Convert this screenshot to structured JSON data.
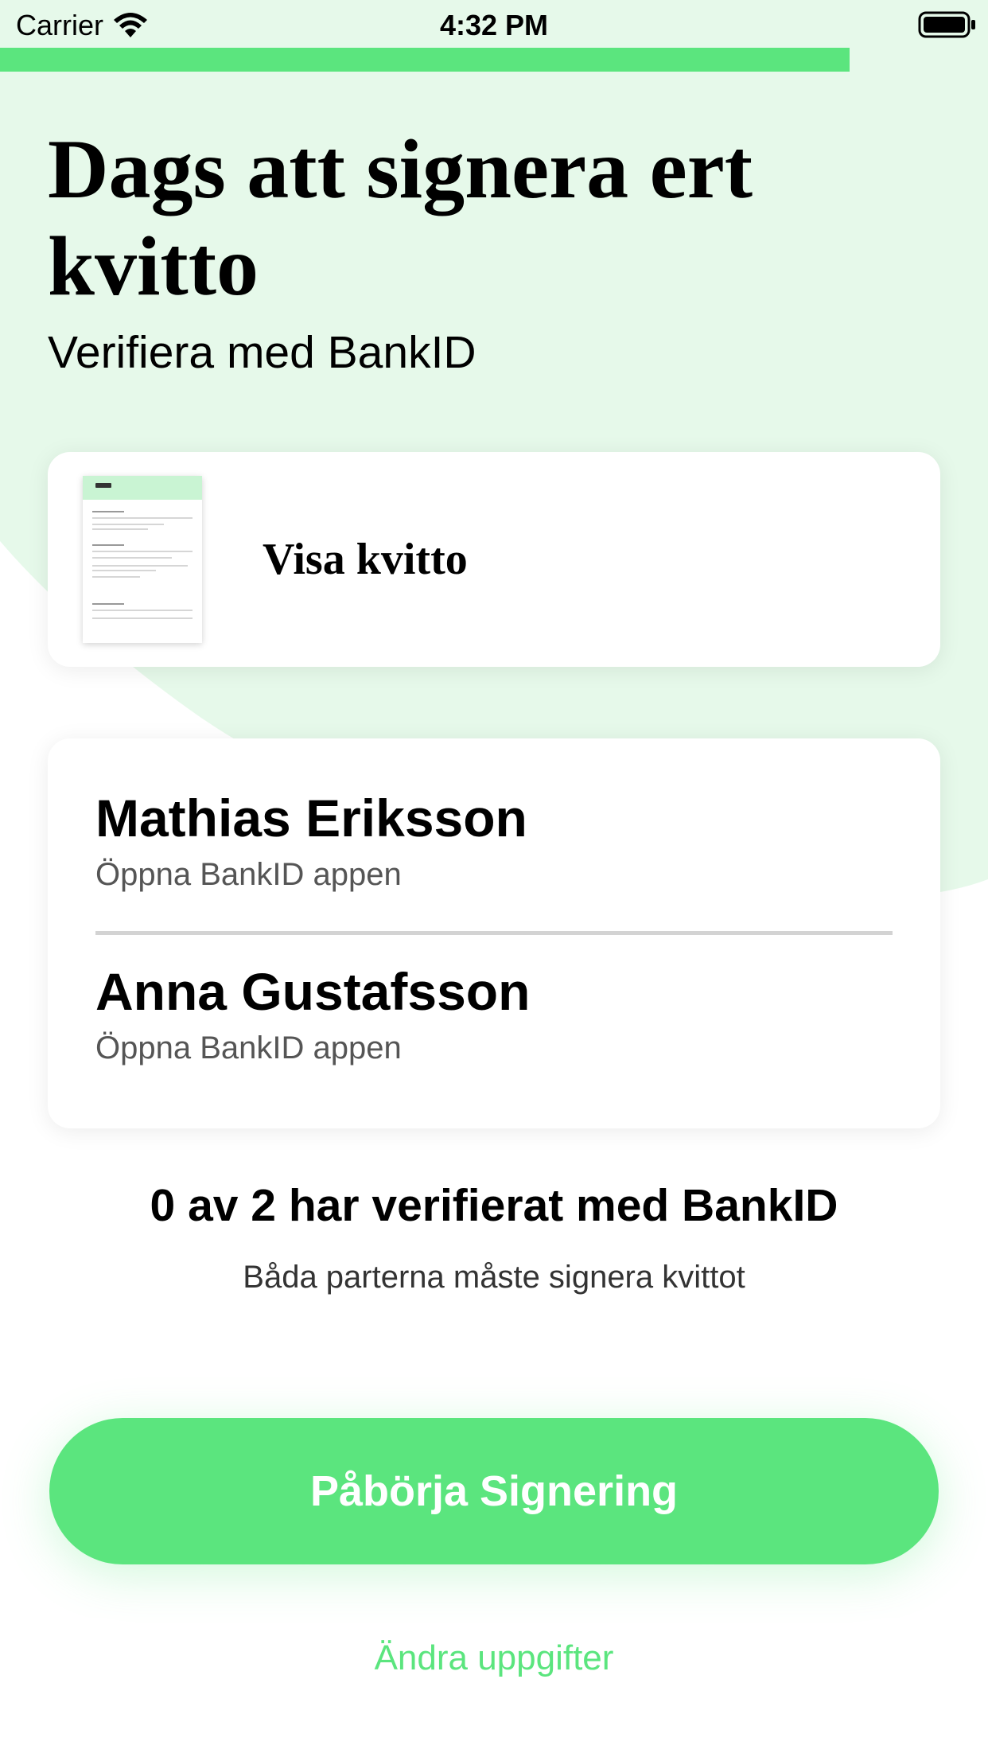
{
  "colors": {
    "accent": "#5be57e",
    "background_tint": "#e6f9ea",
    "white": "#ffffff"
  },
  "status_bar": {
    "carrier": "Carrier",
    "time": "4:32 PM",
    "wifi_icon": "wifi-icon",
    "battery_icon": "battery-full-icon"
  },
  "progress": {
    "fraction": 0.86
  },
  "header": {
    "title": "Dags att signera ert kvitto",
    "subtitle": "Verifiera med BankID"
  },
  "receipt": {
    "label": "Visa kvitto",
    "thumbnail_icon": "receipt-document-icon"
  },
  "signers": [
    {
      "name": "Mathias Eriksson",
      "status": "Öppna BankID appen"
    },
    {
      "name": "Anna Gustafsson",
      "status": "Öppna BankID appen"
    }
  ],
  "verification": {
    "summary": "0 av 2 har verifierat med BankID",
    "note": "Båda parterna måste signera kvittot"
  },
  "actions": {
    "primary_label": "Påbörja Signering",
    "secondary_label": "Ändra uppgifter"
  }
}
